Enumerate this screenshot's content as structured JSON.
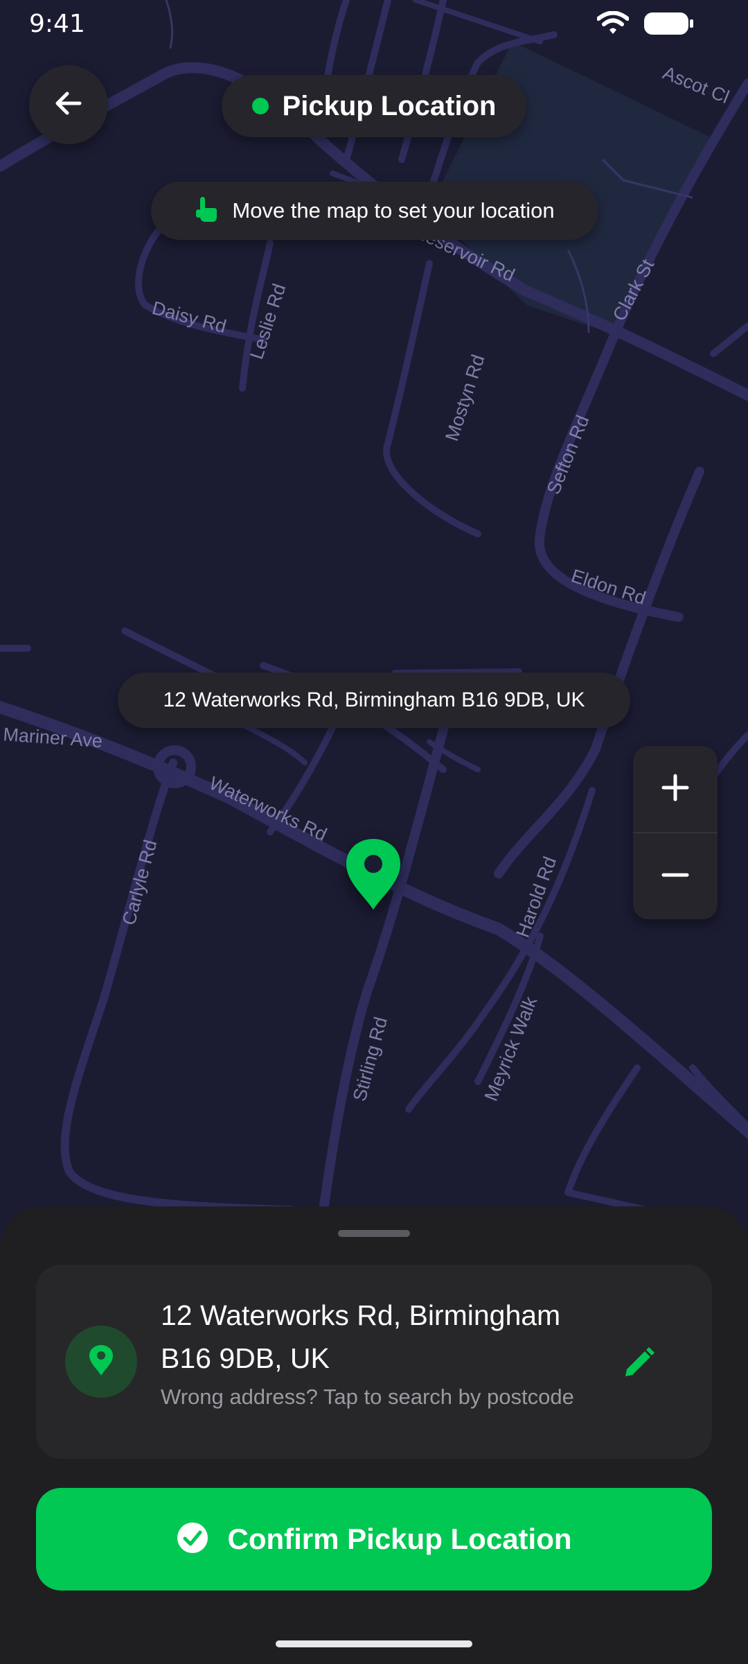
{
  "status_bar": {
    "time": "9:41"
  },
  "header": {
    "title": "Pickup Location",
    "back_icon": "arrow-left-icon"
  },
  "hint": {
    "text": "Move the map to set your location",
    "icon": "hand-pointer-icon"
  },
  "map": {
    "address_label": "12 Waterworks Rd, Birmingham B16 9DB, UK",
    "streets": [
      "Ascot Cl",
      "Reservoir Rd",
      "Daisy Rd",
      "Leslie Rd",
      "Mostyn Rd",
      "Clark St",
      "Sefton Rd",
      "Eldon Rd",
      "Mariner Ave",
      "Waterworks Rd",
      "Carlyle Rd",
      "Harold Rd",
      "Meyrick Walk",
      "Stirling Rd"
    ],
    "zoom_in_icon": "plus-icon",
    "zoom_out_icon": "minus-icon"
  },
  "sheet": {
    "address_line": "12 Waterworks Rd, Birmingham B16 9DB, UK",
    "subtitle": "Wrong address? Tap to search by postcode",
    "edit_icon": "pencil-icon",
    "confirm_label": "Confirm Pickup Location"
  },
  "colors": {
    "accent": "#00c853",
    "map_bg": "#1b1b32",
    "road": "#2e2d5c",
    "surface": "#25252b",
    "sheet": "#1f1f22"
  }
}
